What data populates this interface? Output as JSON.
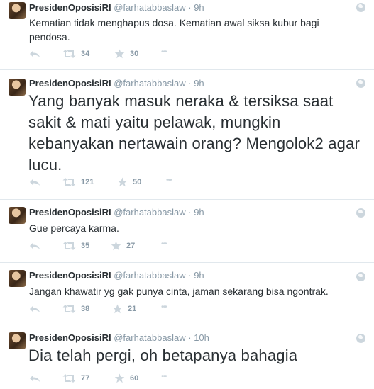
{
  "tweets": [
    {
      "name": "PresidenOposisiRI",
      "handle": "@farhatabbaslaw",
      "separator": "·",
      "time": "9h",
      "text": "Kematian tidak menghapus dosa. Kematian awal siksa kubur bagi pendosa.",
      "retweets": "34",
      "favorites": "30",
      "more": "•••"
    },
    {
      "name": "PresidenOposisiRI",
      "handle": "@farhatabbaslaw",
      "separator": "·",
      "time": "9h",
      "text": "Yang banyak masuk neraka & tersiksa saat sakit & mati yaitu pelawak, mungkin kebanyakan nertawain orang? Mengolok2 agar lucu.",
      "retweets": "121",
      "favorites": "50",
      "more": "•••"
    },
    {
      "name": "PresidenOposisiRI",
      "handle": "@farhatabbaslaw",
      "separator": "·",
      "time": "9h",
      "text": "Gue percaya karma.",
      "retweets": "35",
      "favorites": "27",
      "more": "•••"
    },
    {
      "name": "PresidenOposisiRI",
      "handle": "@farhatabbaslaw",
      "separator": "·",
      "time": "9h",
      "text": "Jangan khawatir yg gak punya cinta, jaman sekarang bisa ngontrak.",
      "retweets": "38",
      "favorites": "21",
      "more": "•••"
    },
    {
      "name": "PresidenOposisiRI",
      "handle": "@farhatabbaslaw",
      "separator": "·",
      "time": "10h",
      "text": "Dia telah pergi, oh betapanya bahagia",
      "retweets": "77",
      "favorites": "60",
      "more": "•••"
    }
  ],
  "icons": {
    "reply": "reply-icon",
    "retweet": "retweet-icon",
    "favorite": "star-icon",
    "more": "more-icon",
    "globe": "globe-icon"
  },
  "colors": {
    "text": "#292f33",
    "muted": "#8899a6",
    "divider": "#e1e8ed"
  }
}
